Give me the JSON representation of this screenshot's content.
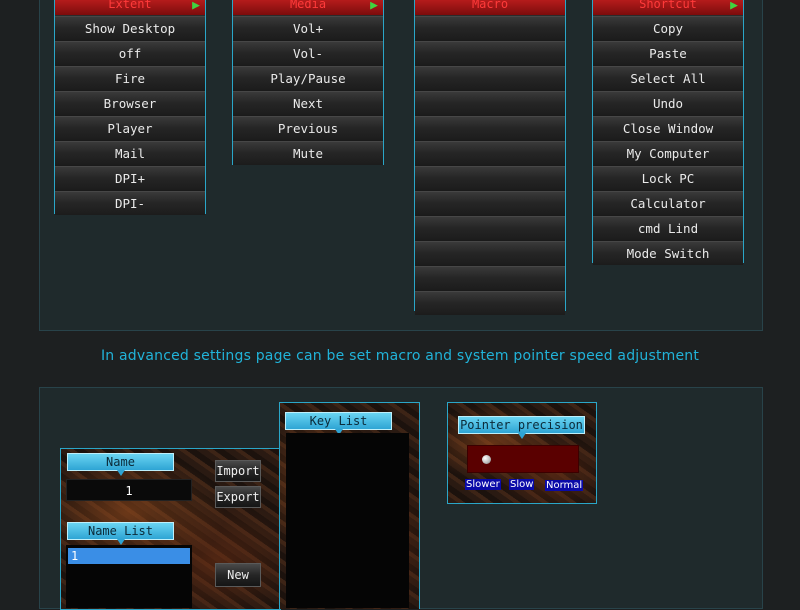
{
  "menus": [
    {
      "header": "Extent",
      "items": [
        "Show Desktop",
        "off",
        "Fire",
        "Browser",
        "Player",
        "Mail",
        "DPI+",
        "DPI-"
      ]
    },
    {
      "header": "Media",
      "items": [
        "Vol+",
        "Vol-",
        "Play/Pause",
        "Next",
        "Previous",
        "Mute"
      ]
    },
    {
      "header": "Macro",
      "items": [
        "",
        "",
        "",
        "",
        "",
        "",
        "",
        "",
        "",
        "",
        "",
        ""
      ]
    },
    {
      "header": "Shortcut",
      "items": [
        "Copy",
        "Paste",
        "Select All",
        "Undo",
        "Close Window",
        "My Computer",
        "Lock PC",
        "Calculator",
        "cmd Lind",
        "Mode Switch"
      ]
    }
  ],
  "caption": "In advanced settings page can be set macro and system pointer speed adjustment",
  "macro_panel": {
    "key_list_label": "Key List",
    "name_label": "Name",
    "name_value": "1",
    "import_label": "Import",
    "export_label": "Export",
    "name_list_label": "Name List",
    "name_list_items": [
      "1"
    ],
    "new_label": "New"
  },
  "pointer_panel": {
    "title": "Pointer precision",
    "slider_value": 0.0,
    "speed_labels": [
      "Slower",
      "Slow",
      "Normal"
    ]
  },
  "colors": {
    "accent": "#21b3d9",
    "menu_header": "#a81a1a",
    "selection": "#3a8ee6"
  }
}
